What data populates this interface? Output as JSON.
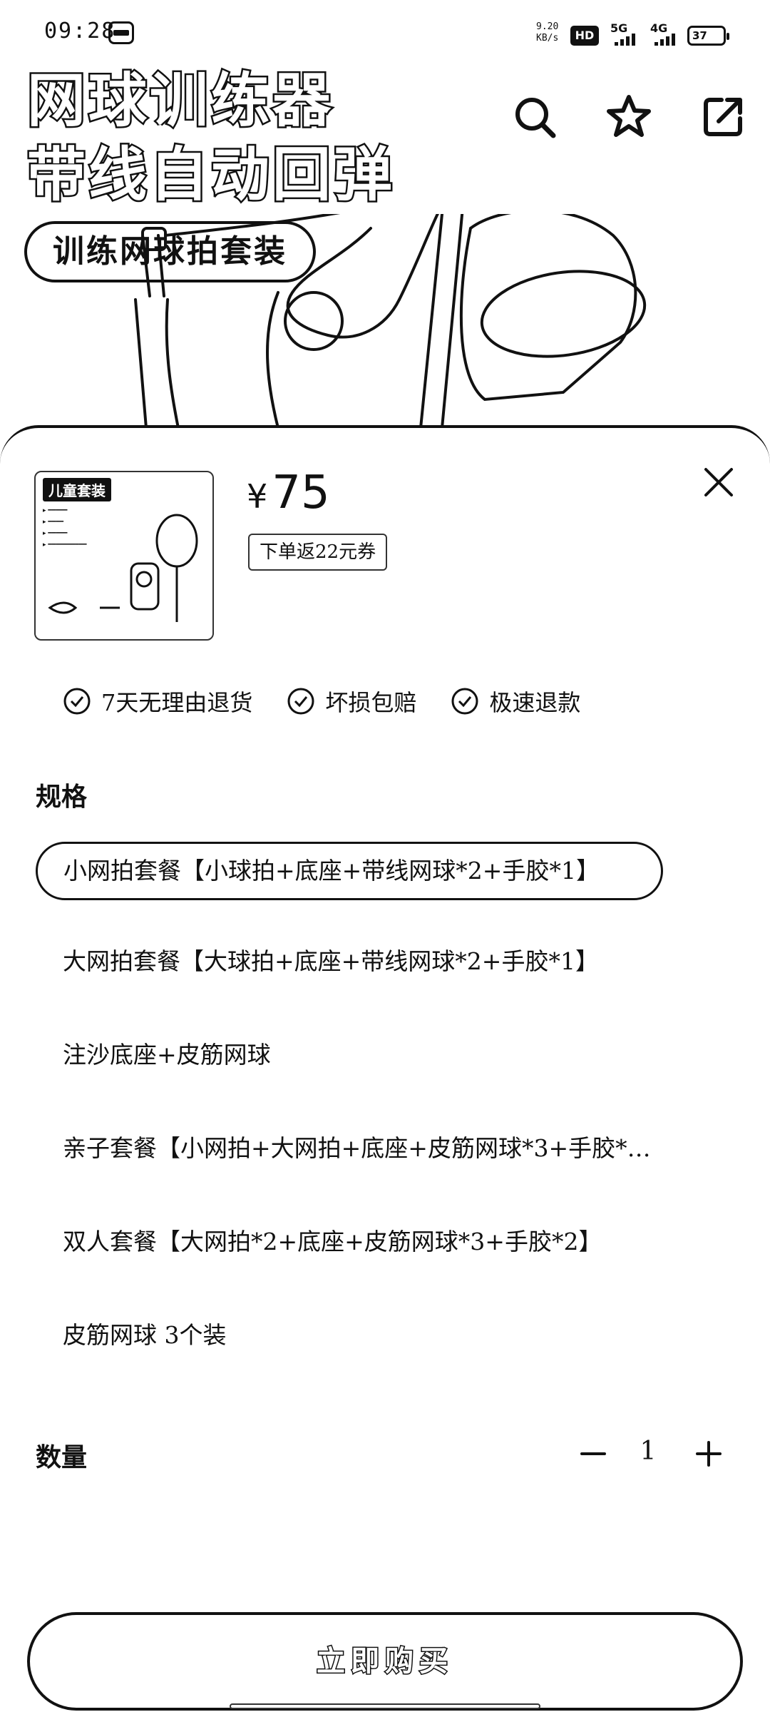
{
  "status_bar": {
    "time": "09:28",
    "speed_value": "9.20",
    "speed_unit": "KB/s",
    "hd": "HD",
    "sim1": "5G",
    "sim2": "4G",
    "battery": "37"
  },
  "banner": {
    "title_line1": "网球训练器",
    "title_line2": "带线自动回弹",
    "pill": "训练网球拍套装",
    "icons": [
      "search-icon",
      "star-icon",
      "share-icon"
    ]
  },
  "product": {
    "thumb_tag": "儿童套装",
    "currency": "¥",
    "price": "75",
    "coupon": "下单返22元券"
  },
  "guarantees": [
    "7天无理由退货",
    "坏损包赔",
    "极速退款"
  ],
  "spec": {
    "label": "规格",
    "options": [
      "小网拍套餐【小球拍+底座+带线网球*2+手胶*1】",
      "大网拍套餐【大球拍+底座+带线网球*2+手胶*1】",
      "注沙底座+皮筋网球",
      "亲子套餐【小网拍+大网拍+底座+皮筋网球*3+手胶*…",
      "双人套餐【大网拍*2+底座+皮筋网球*3+手胶*2】",
      "皮筋网球 3个装"
    ],
    "selected_index": 0
  },
  "quantity": {
    "label": "数量",
    "value": "1"
  },
  "buy_button": "立即购买"
}
